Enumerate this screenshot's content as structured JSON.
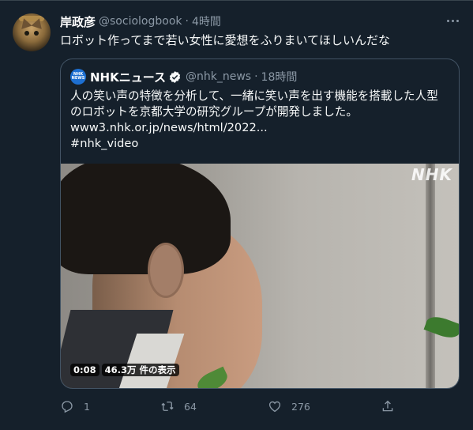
{
  "tweet": {
    "author_name": "岸政彦",
    "author_handle": "@sociologbook",
    "separator": "·",
    "time": "4時間",
    "text": "ロボット作ってまで若い女性に愛想をふりまいてほしいんだな"
  },
  "quoted_tweet": {
    "avatar_label_1": "NHK",
    "avatar_label_2": "NEWS",
    "author_name": "NHKニュース",
    "author_handle": "@nhk_news",
    "separator": "·",
    "time": "18時間",
    "text_line_1": "人の笑い声の特徴を分析して、一緒に笑い声を出す機能を搭載した人型",
    "text_line_2": "のロボットを京都大学の研究グループが開発しました。",
    "link": "www3.nhk.or.jp/news/html/2022...",
    "hashtag": "#nhk_video",
    "video": {
      "watermark": "NHK",
      "duration": "0:08",
      "views": "46.3万 件の表示"
    }
  },
  "actions": {
    "reply_count": "1",
    "retweet_count": "64",
    "like_count": "276"
  },
  "icons": [
    "more-icon",
    "verified-icon",
    "reply-icon",
    "retweet-icon",
    "like-icon",
    "share-icon"
  ],
  "colors": {
    "background": "#15202b",
    "secondary_text": "#8b98a5",
    "verified": "#1d9bf0",
    "link": "#f7f9f9"
  }
}
